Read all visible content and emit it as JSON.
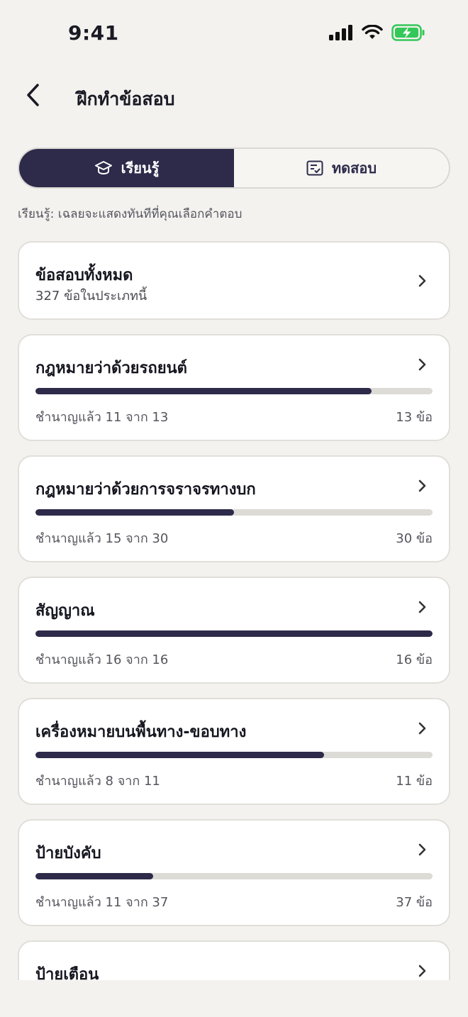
{
  "status_bar": {
    "time": "9:41"
  },
  "nav": {
    "title": "ฝึกทำข้อสอบ"
  },
  "mode_tabs": [
    {
      "label": "เรียนรู้",
      "icon": "graduation-cap-icon",
      "active": true
    },
    {
      "label": "ทดสอบ",
      "icon": "checklist-icon",
      "active": false
    }
  ],
  "mode_hint": "เรียนรู้: เฉลยจะแสดงทันทีที่คุณเลือกคำตอบ",
  "all_questions": {
    "title": "ข้อสอบทั้งหมด",
    "subtitle": "327 ข้อในประเภทนี้"
  },
  "categories": [
    {
      "title": "กฎหมายว่าด้วยรถยนต์",
      "mastered": "ชำนาญแล้ว 11 จาก 13",
      "count": "13 ข้อ",
      "progress": 0.846
    },
    {
      "title": "กฎหมายว่าด้วยการจราจรทางบก",
      "mastered": "ชำนาญแล้ว 15 จาก 30",
      "count": "30 ข้อ",
      "progress": 0.5
    },
    {
      "title": "สัญญาณ",
      "mastered": "ชำนาญแล้ว 16 จาก 16",
      "count": "16 ข้อ",
      "progress": 1.0
    },
    {
      "title": "เครื่องหมายบนพื้นทาง-ขอบทาง",
      "mastered": "ชำนาญแล้ว 8 จาก 11",
      "count": "11 ข้อ",
      "progress": 0.727
    },
    {
      "title": "ป้ายบังคับ",
      "mastered": "ชำนาญแล้ว 11 จาก 37",
      "count": "37 ข้อ",
      "progress": 0.297
    },
    {
      "title": "ป้ายเตือน"
    }
  ],
  "colors": {
    "accent": "#2d2a4a",
    "track": "#dcdbd6",
    "battery": "#34c759",
    "background": "#f3f2ef"
  }
}
